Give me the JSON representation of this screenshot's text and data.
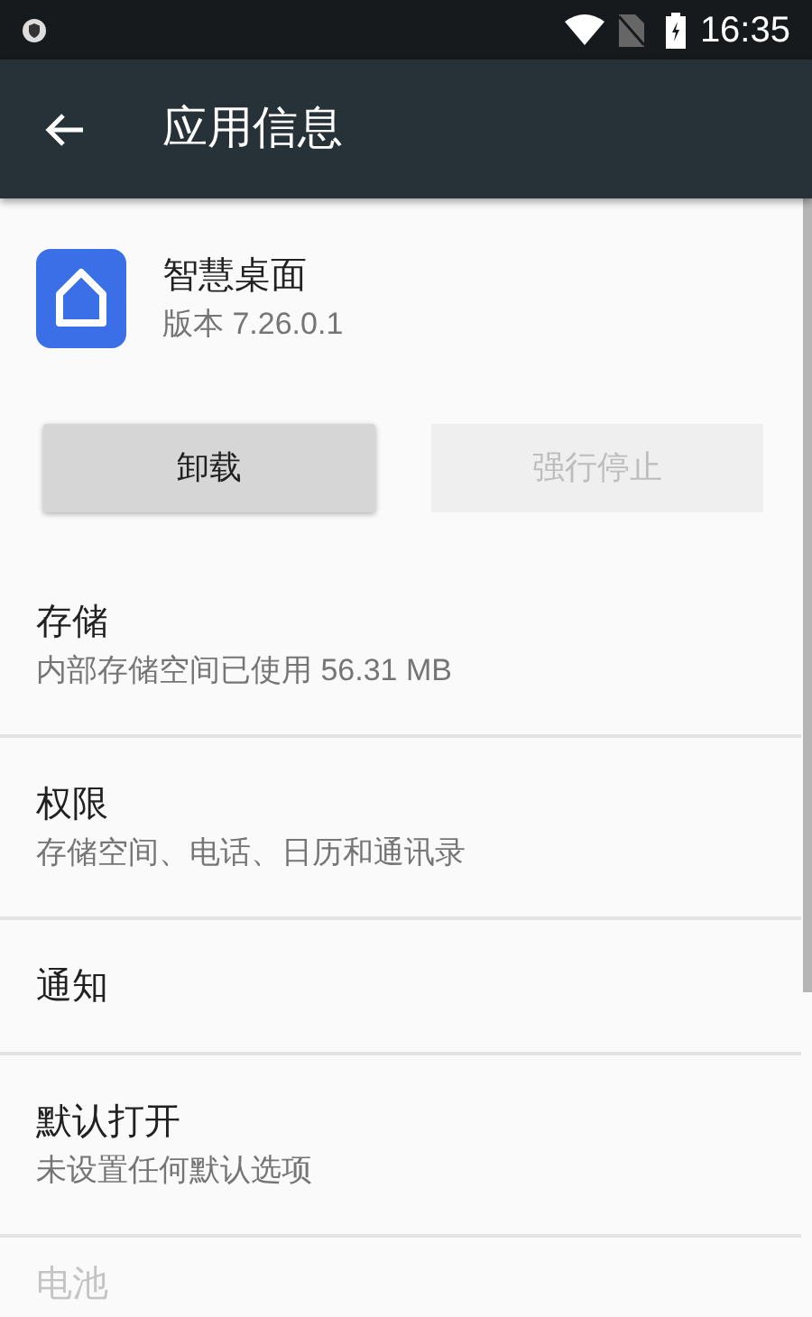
{
  "status_bar": {
    "time": "16:35"
  },
  "app_bar": {
    "title": "应用信息"
  },
  "app": {
    "name": "智慧桌面",
    "version": "版本 7.26.0.1"
  },
  "buttons": [
    {
      "label": "卸载",
      "disabled": false
    },
    {
      "label": "强行停止",
      "disabled": true
    }
  ],
  "items": [
    {
      "title": "存储",
      "subtitle": "内部存储空间已使用 56.31 MB",
      "disabled": false
    },
    {
      "title": "权限",
      "subtitle": "存储空间、电话、日历和通讯录",
      "disabled": false
    },
    {
      "title": "通知",
      "disabled": false
    },
    {
      "title": "默认打开",
      "subtitle": "未设置任何默认选项",
      "disabled": false
    },
    {
      "title": "电池",
      "disabled": true
    }
  ]
}
